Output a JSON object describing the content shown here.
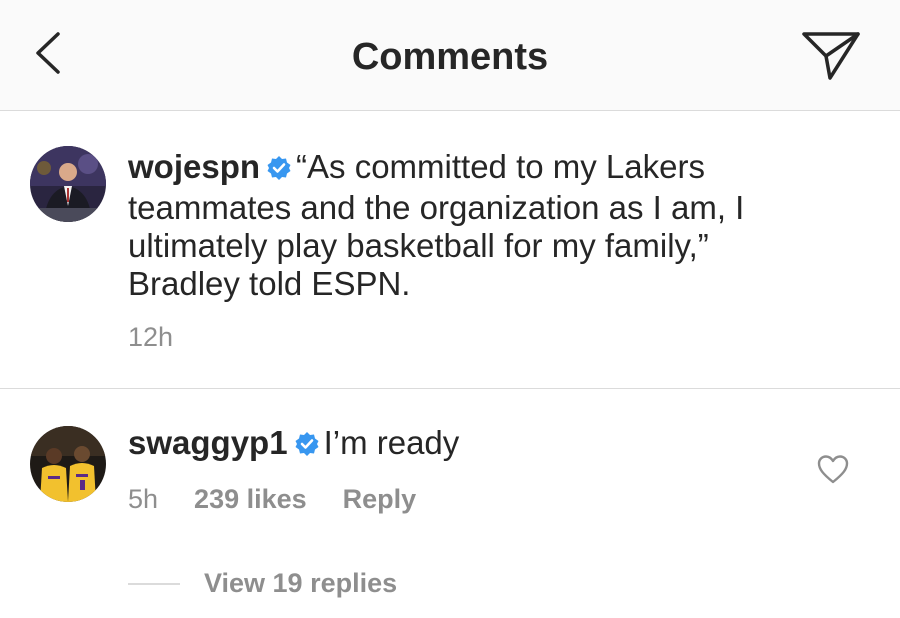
{
  "header": {
    "title": "Comments",
    "back_icon": "chevron-left-icon",
    "send_icon": "paper-plane-icon"
  },
  "post": {
    "username": "wojespn",
    "verified": true,
    "text": "“As committed to my Lakers teammates and the organization as I am, I ultimately play basketball for my family,” Bradley told ESPN.",
    "time": "12h"
  },
  "comments": [
    {
      "username": "swaggyp1",
      "verified": true,
      "text": "I’m ready",
      "time": "5h",
      "likes": "239 likes",
      "reply_label": "Reply",
      "view_replies": "View 19 replies"
    }
  ],
  "colors": {
    "text": "#262626",
    "secondary": "#8e8e8e",
    "verified_blue": "#3897f0",
    "divider": "#dbdbdb",
    "header_bg": "#fafafa"
  }
}
